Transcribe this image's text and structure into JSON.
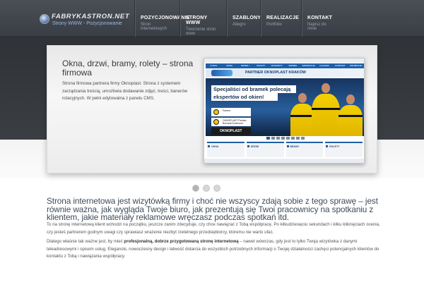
{
  "header": {
    "logo_text": "FABRYKASTRON.NET",
    "logo_subtitle": "Strony WWW - Pozycjonowanie",
    "nav": [
      {
        "title": "POZYCJONOWANIE",
        "subtitle": "Stron internetowych"
      },
      {
        "title": "STRONY WWW",
        "subtitle": "Tworzenie stron www"
      },
      {
        "title": "SZABLONY",
        "subtitle": "Allegro"
      },
      {
        "title": "REALIZACJE",
        "subtitle": "Portfolio"
      },
      {
        "title": "KONTAKT",
        "subtitle": "Napisz do mnie"
      }
    ]
  },
  "slider": {
    "title": "Okna, drzwi, bramy, rolety – strona firmowa",
    "text": "Strona firmowa partnera firmy Oknoplast. Strona z systemem zarządzania treścią, umożliwia dodawanie zdjęć, treści, banerów rotacyjnych. W pełni edytowalna z panelu CMS.",
    "screenshot": {
      "nav": [
        "O NAS",
        "OKNA",
        "DRZWI I BRAMY",
        "ROLETY",
        "PARAPETY",
        "SERWIS",
        "INSPIRACJE",
        "GALERIA",
        "KONTAKT",
        "PROMOCJE"
      ],
      "partner_text": "PARTNER OKNOPLAST KRAKÓW",
      "headline_line1": "Specjaliści od bramek polecają",
      "headline_line2": "ekspertów od okien!",
      "card1_text": "Partner",
      "card2_text": "OKNOPLAST Partner Borussii Dortmund",
      "okno_logo": "OKNOPLAST",
      "tiles": [
        "OKNA",
        "DRZWI",
        "BRAMY",
        "ROLETY"
      ]
    },
    "dots": 3,
    "active_dot": 0
  },
  "content": {
    "heading": "Strona internetowa jest wizytówką firmy i choć nie wszyscy zdają sobie z tego sprawę – jest równie ważna, jak wygląda Twoje biuro, jak prezentują się Twoi pracownicy na spotkaniu z klientem, jakie materiały reklamowe wręczasz podczas spotkań itd.",
    "para1": "To na stronę internetową klient wchodzi na początku, jeszcze zanim zdecyduje, czy chce nawiązać z Tobą współpracę. Po kilkudziesięciu sekundach i kilku kliknięciach ocenia, czy jesteś partnerem godnym uwagi czy sprawiasz wrażenie niezbyt rzetelnego przedsiębiorcy, któremu nie warto ufać.",
    "para2_start": "Dlatego właśnie tak ważne jest, by mieć ",
    "para2_bold": "profesjonalną, dobrze przygotowaną stronę internetową",
    "para2_end": " – nawet wówczas, gdy jest to tylko Twoja wizytówka z danymi teleadresowymi i opisem usług. Elegancki, nowoczesny design i łatwość dotarcia do wszystkich potrzebnych informacji o Twojej działalności zachęci potencjalnych klientów do kontaktu z Tobą i nawiązania współpracy."
  }
}
